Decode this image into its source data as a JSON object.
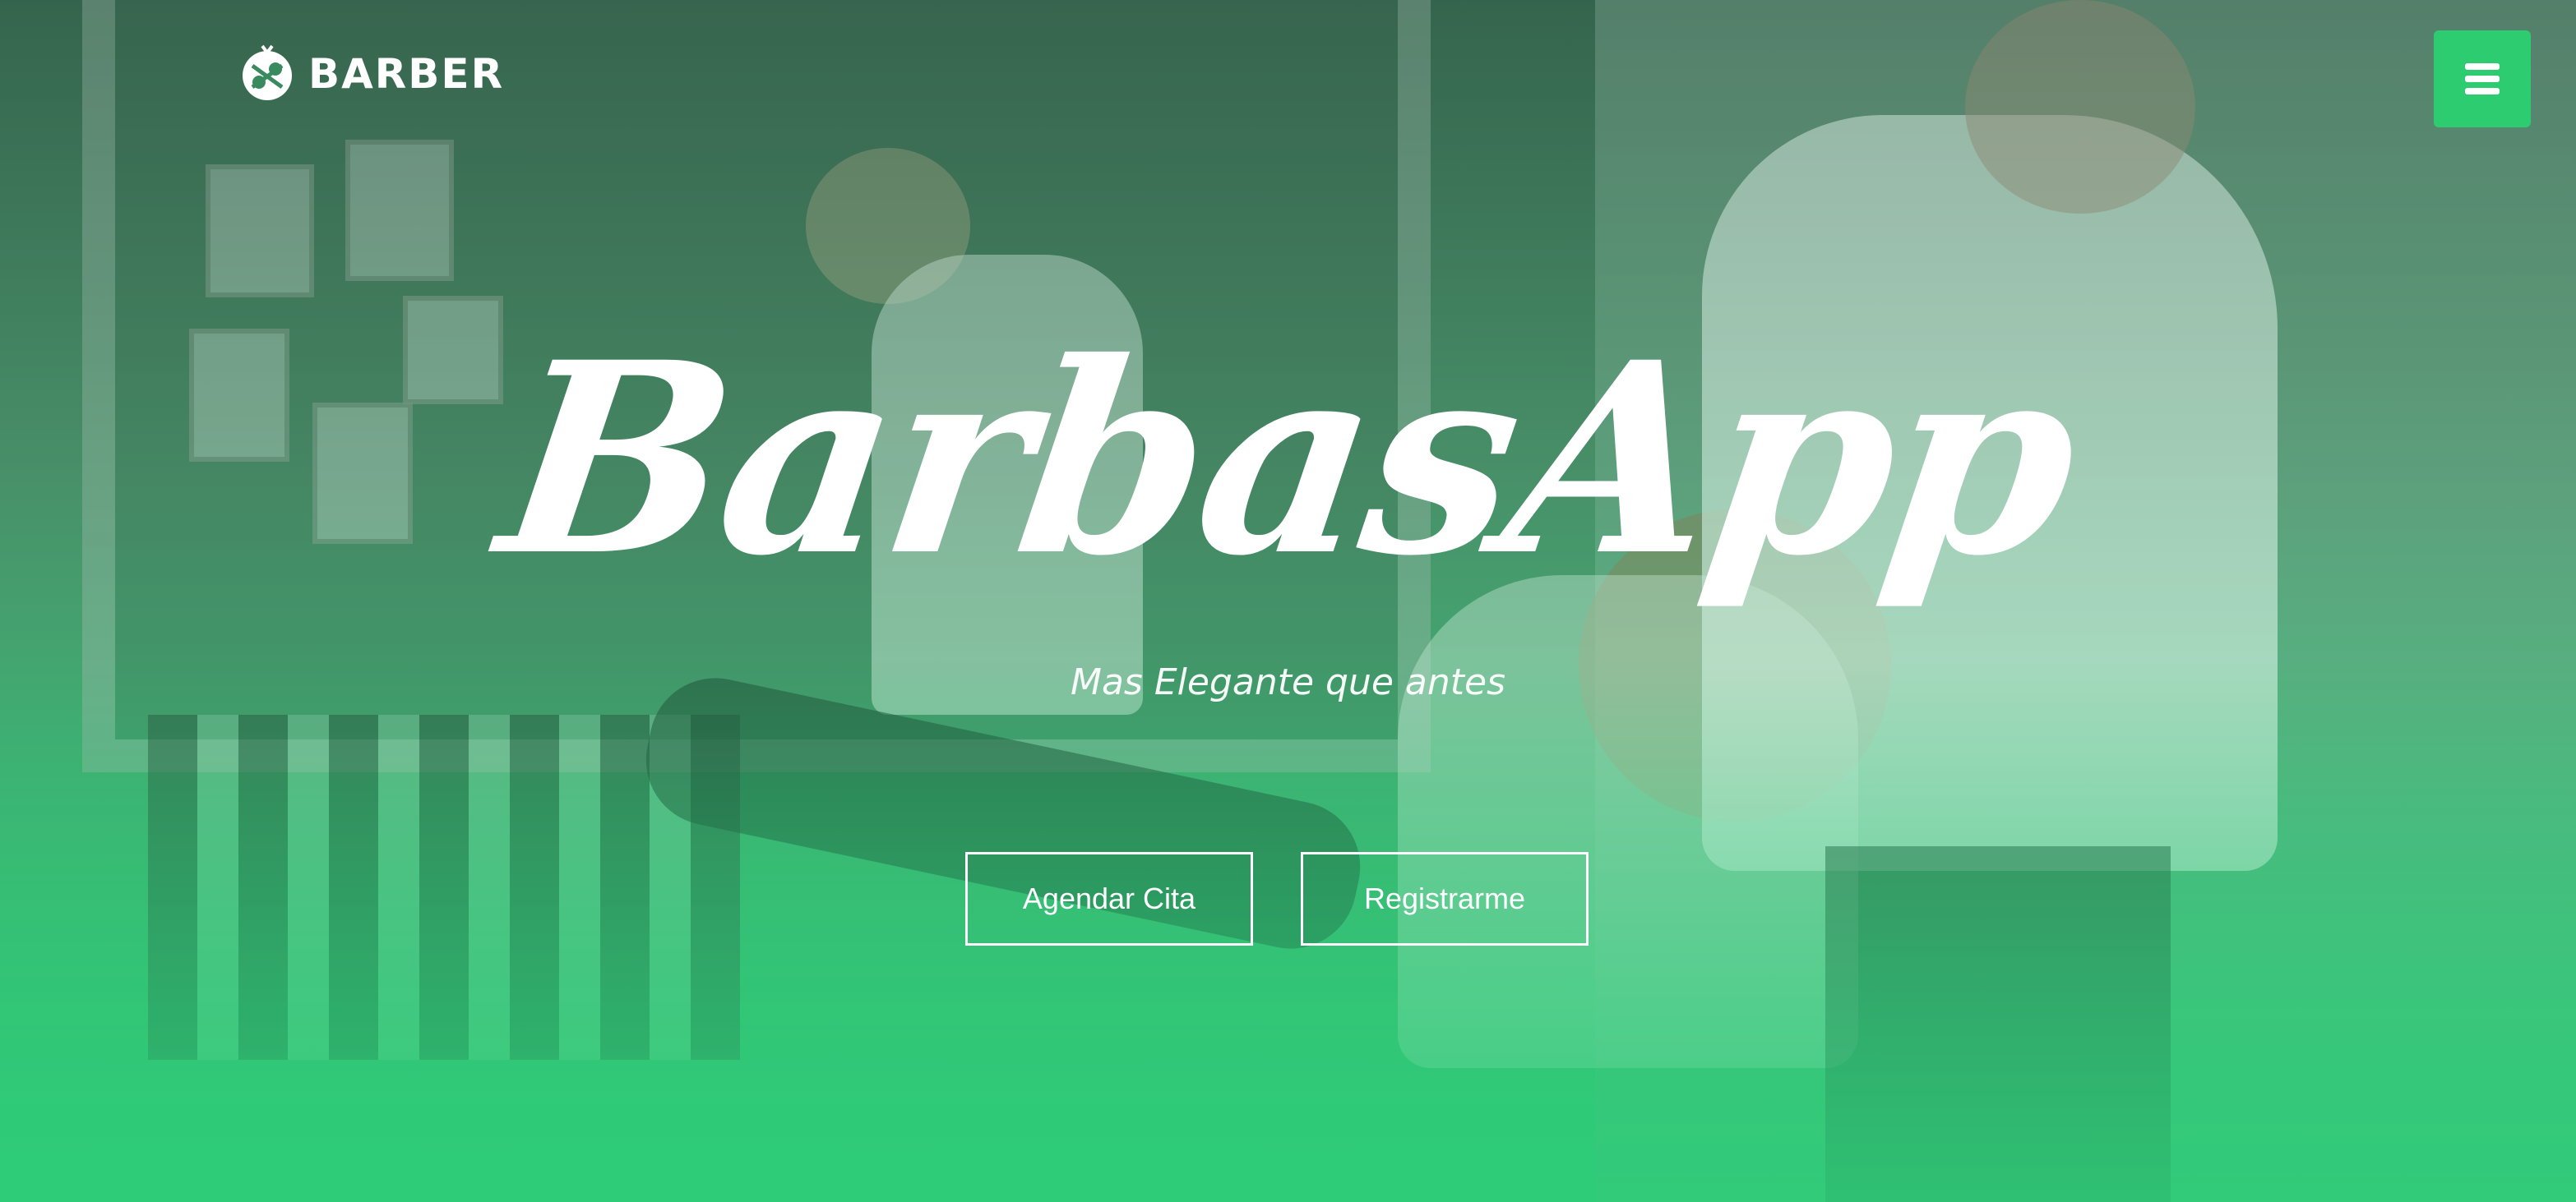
{
  "header": {
    "brand_name": "BARBER",
    "logo_icon": "barber-scissors-logo-icon",
    "menu_icon": "hamburger-menu-icon"
  },
  "hero": {
    "title": "BarbasApp",
    "subtitle": "Mas Elegante que antes",
    "buttons": [
      {
        "label": "Agendar Cita"
      },
      {
        "label": "Registrarme"
      }
    ]
  },
  "colors": {
    "accent": "#2ecc71",
    "text": "#ffffff"
  }
}
